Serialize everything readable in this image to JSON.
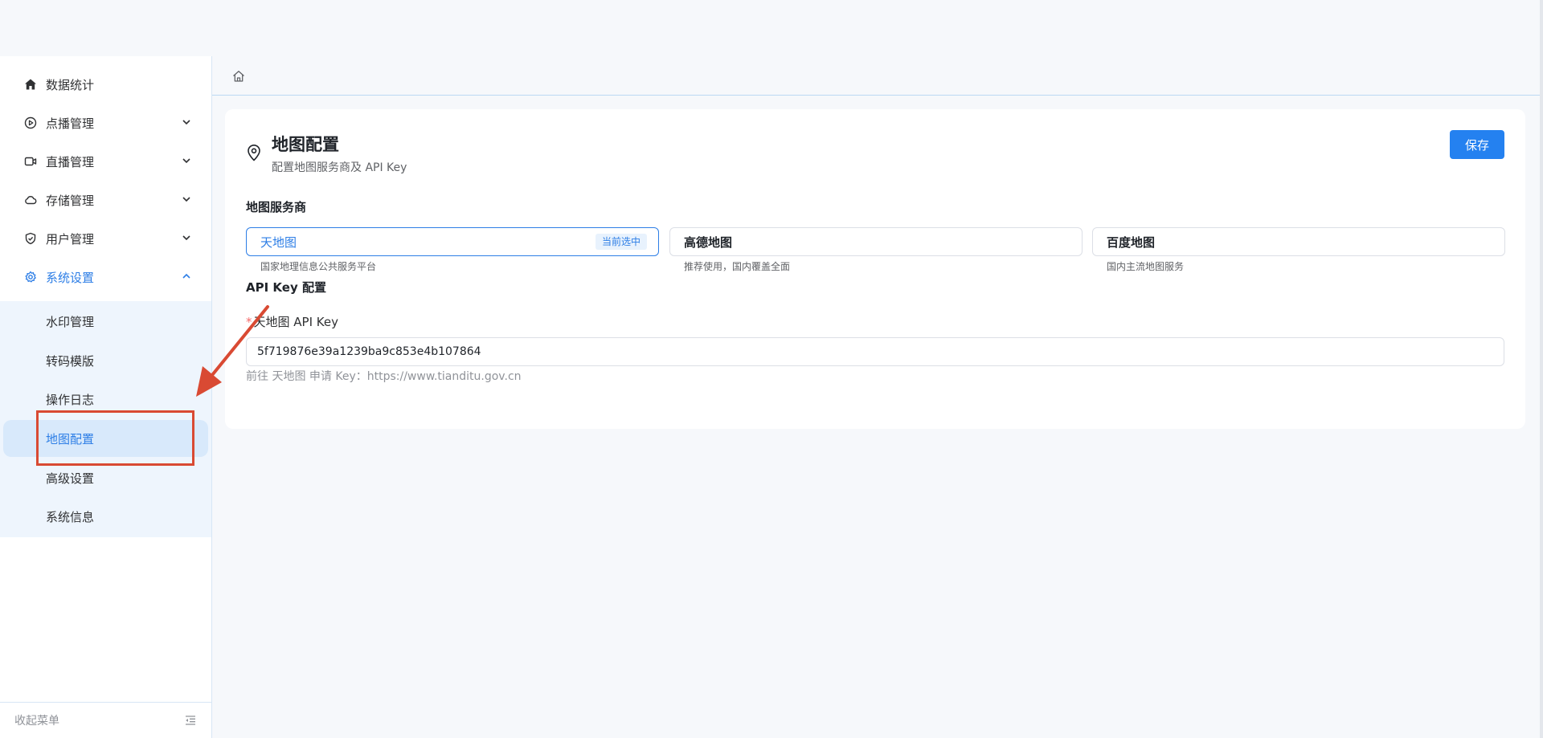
{
  "sidebar": {
    "items": [
      {
        "label": "数据统计",
        "icon": "home-icon"
      },
      {
        "label": "点播管理",
        "icon": "play-circle-icon"
      },
      {
        "label": "直播管理",
        "icon": "video-camera-icon"
      },
      {
        "label": "存储管理",
        "icon": "cloud-icon"
      },
      {
        "label": "用户管理",
        "icon": "shield-check-icon"
      },
      {
        "label": "系统设置",
        "icon": "gear-icon"
      }
    ],
    "sub_items": [
      {
        "label": "水印管理"
      },
      {
        "label": "转码模版"
      },
      {
        "label": "操作日志"
      },
      {
        "label": "地图配置"
      },
      {
        "label": "高级设置"
      },
      {
        "label": "系统信息"
      }
    ],
    "collapse_label": "收起菜单"
  },
  "page": {
    "title": "地图配置",
    "subtitle": "配置地图服务商及 API Key",
    "save_label": "保存",
    "provider_section_label": "地图服务商",
    "providers": [
      {
        "name": "天地图",
        "desc": "国家地理信息公共服务平台",
        "badge": "当前选中"
      },
      {
        "name": "高德地图",
        "desc": "推荐使用，国内覆盖全面"
      },
      {
        "name": "百度地图",
        "desc": "国内主流地图服务"
      }
    ],
    "api_section_label": "API Key 配置",
    "api_field_label": "天地图 API Key",
    "api_required_mark": "*",
    "api_key_value": "5f719876e39a1239ba9c853e4b107864",
    "api_hint": "前往 天地图 申请 Key：https://www.tianditu.gov.cn"
  },
  "colors": {
    "accent": "#2d7ee6",
    "primary_button": "#2481f0",
    "annotation": "#d94a33",
    "required": "#f56c6c"
  }
}
